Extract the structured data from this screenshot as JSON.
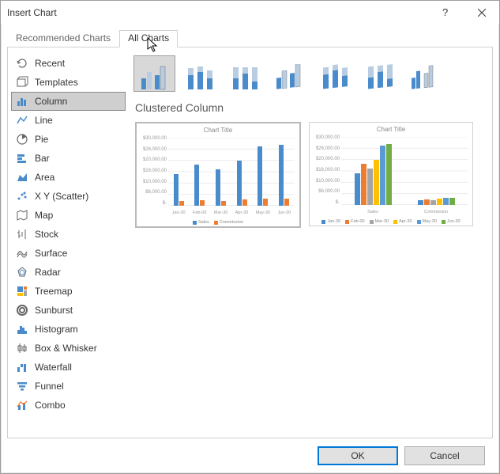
{
  "window_title": "Insert Chart",
  "tabs": {
    "recommended": "Recommended Charts",
    "all": "All Charts"
  },
  "sidebar": {
    "items": [
      {
        "label": "Recent",
        "icon": "recent-icon"
      },
      {
        "label": "Templates",
        "icon": "templates-icon"
      },
      {
        "label": "Column",
        "icon": "column-icon"
      },
      {
        "label": "Line",
        "icon": "line-icon"
      },
      {
        "label": "Pie",
        "icon": "pie-icon"
      },
      {
        "label": "Bar",
        "icon": "bar-icon"
      },
      {
        "label": "Area",
        "icon": "area-icon"
      },
      {
        "label": "X Y (Scatter)",
        "icon": "scatter-icon"
      },
      {
        "label": "Map",
        "icon": "map-icon"
      },
      {
        "label": "Stock",
        "icon": "stock-icon"
      },
      {
        "label": "Surface",
        "icon": "surface-icon"
      },
      {
        "label": "Radar",
        "icon": "radar-icon"
      },
      {
        "label": "Treemap",
        "icon": "treemap-icon"
      },
      {
        "label": "Sunburst",
        "icon": "sunburst-icon"
      },
      {
        "label": "Histogram",
        "icon": "histogram-icon"
      },
      {
        "label": "Box & Whisker",
        "icon": "box-whisker-icon"
      },
      {
        "label": "Waterfall",
        "icon": "waterfall-icon"
      },
      {
        "label": "Funnel",
        "icon": "funnel-icon"
      },
      {
        "label": "Combo",
        "icon": "combo-icon"
      }
    ]
  },
  "subtitle": "Clustered Column",
  "preview_title": "Chart Title",
  "yaxis_ticks": [
    "$-",
    "$6,000.00",
    "$10,000.00",
    "$16,000.00",
    "$20,000.00",
    "$26,000.00",
    "$30,000.00"
  ],
  "x_categories": [
    "Jan-30",
    "Feb-00",
    "Mar-30",
    "Apr-30",
    "May-30",
    "Jun-30"
  ],
  "legend1": [
    "Sales",
    "Commission"
  ],
  "groups2": [
    "Sales",
    "Commission"
  ],
  "legend2": [
    "Jan-30",
    "Feb-00",
    "Mar-30",
    "Apr-30",
    "May-30",
    "Jun-30"
  ],
  "buttons": {
    "ok": "OK",
    "cancel": "Cancel"
  },
  "colors": {
    "blue": "#4a8ccb",
    "orange": "#ed7d31",
    "gray": "#a5a5a5",
    "yellow": "#ffc000",
    "lightblue": "#5b9bd5",
    "green": "#70ad47"
  },
  "chart_data": [
    {
      "type": "bar",
      "title": "Chart Title",
      "categories": [
        "Jan-30",
        "Feb-00",
        "Mar-30",
        "Apr-30",
        "May-30",
        "Jun-30"
      ],
      "series": [
        {
          "name": "Sales",
          "values": [
            14000,
            18000,
            16000,
            20000,
            26000,
            27000
          ]
        },
        {
          "name": "Commission",
          "values": [
            2000,
            2500,
            2200,
            2800,
            3000,
            3200
          ]
        }
      ],
      "ylim": [
        0,
        30000
      ]
    },
    {
      "type": "bar",
      "title": "Chart Title",
      "categories": [
        "Sales",
        "Commission"
      ],
      "series": [
        {
          "name": "Jan-30",
          "values": [
            14000,
            2000
          ]
        },
        {
          "name": "Feb-00",
          "values": [
            18000,
            2500
          ]
        },
        {
          "name": "Mar-30",
          "values": [
            16000,
            2200
          ]
        },
        {
          "name": "Apr-30",
          "values": [
            20000,
            2800
          ]
        },
        {
          "name": "May-30",
          "values": [
            26000,
            3000
          ]
        },
        {
          "name": "Jun-30",
          "values": [
            27000,
            3200
          ]
        }
      ],
      "ylim": [
        0,
        30000
      ]
    }
  ]
}
